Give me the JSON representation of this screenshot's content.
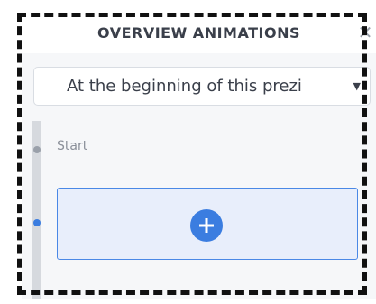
{
  "panel": {
    "title": "OVERVIEW ANIMATIONS",
    "close_icon": "close-icon"
  },
  "dropdown": {
    "selected": "At the beginning of this prezi",
    "arrow": "▼"
  },
  "timeline": {
    "start_label": "Start",
    "add_icon": "plus-circle-icon"
  },
  "colors": {
    "accent": "#3b7de0",
    "add_box_bg": "#e8eefb",
    "rail": "#d6d9de",
    "title_text": "#3a3f4a"
  }
}
